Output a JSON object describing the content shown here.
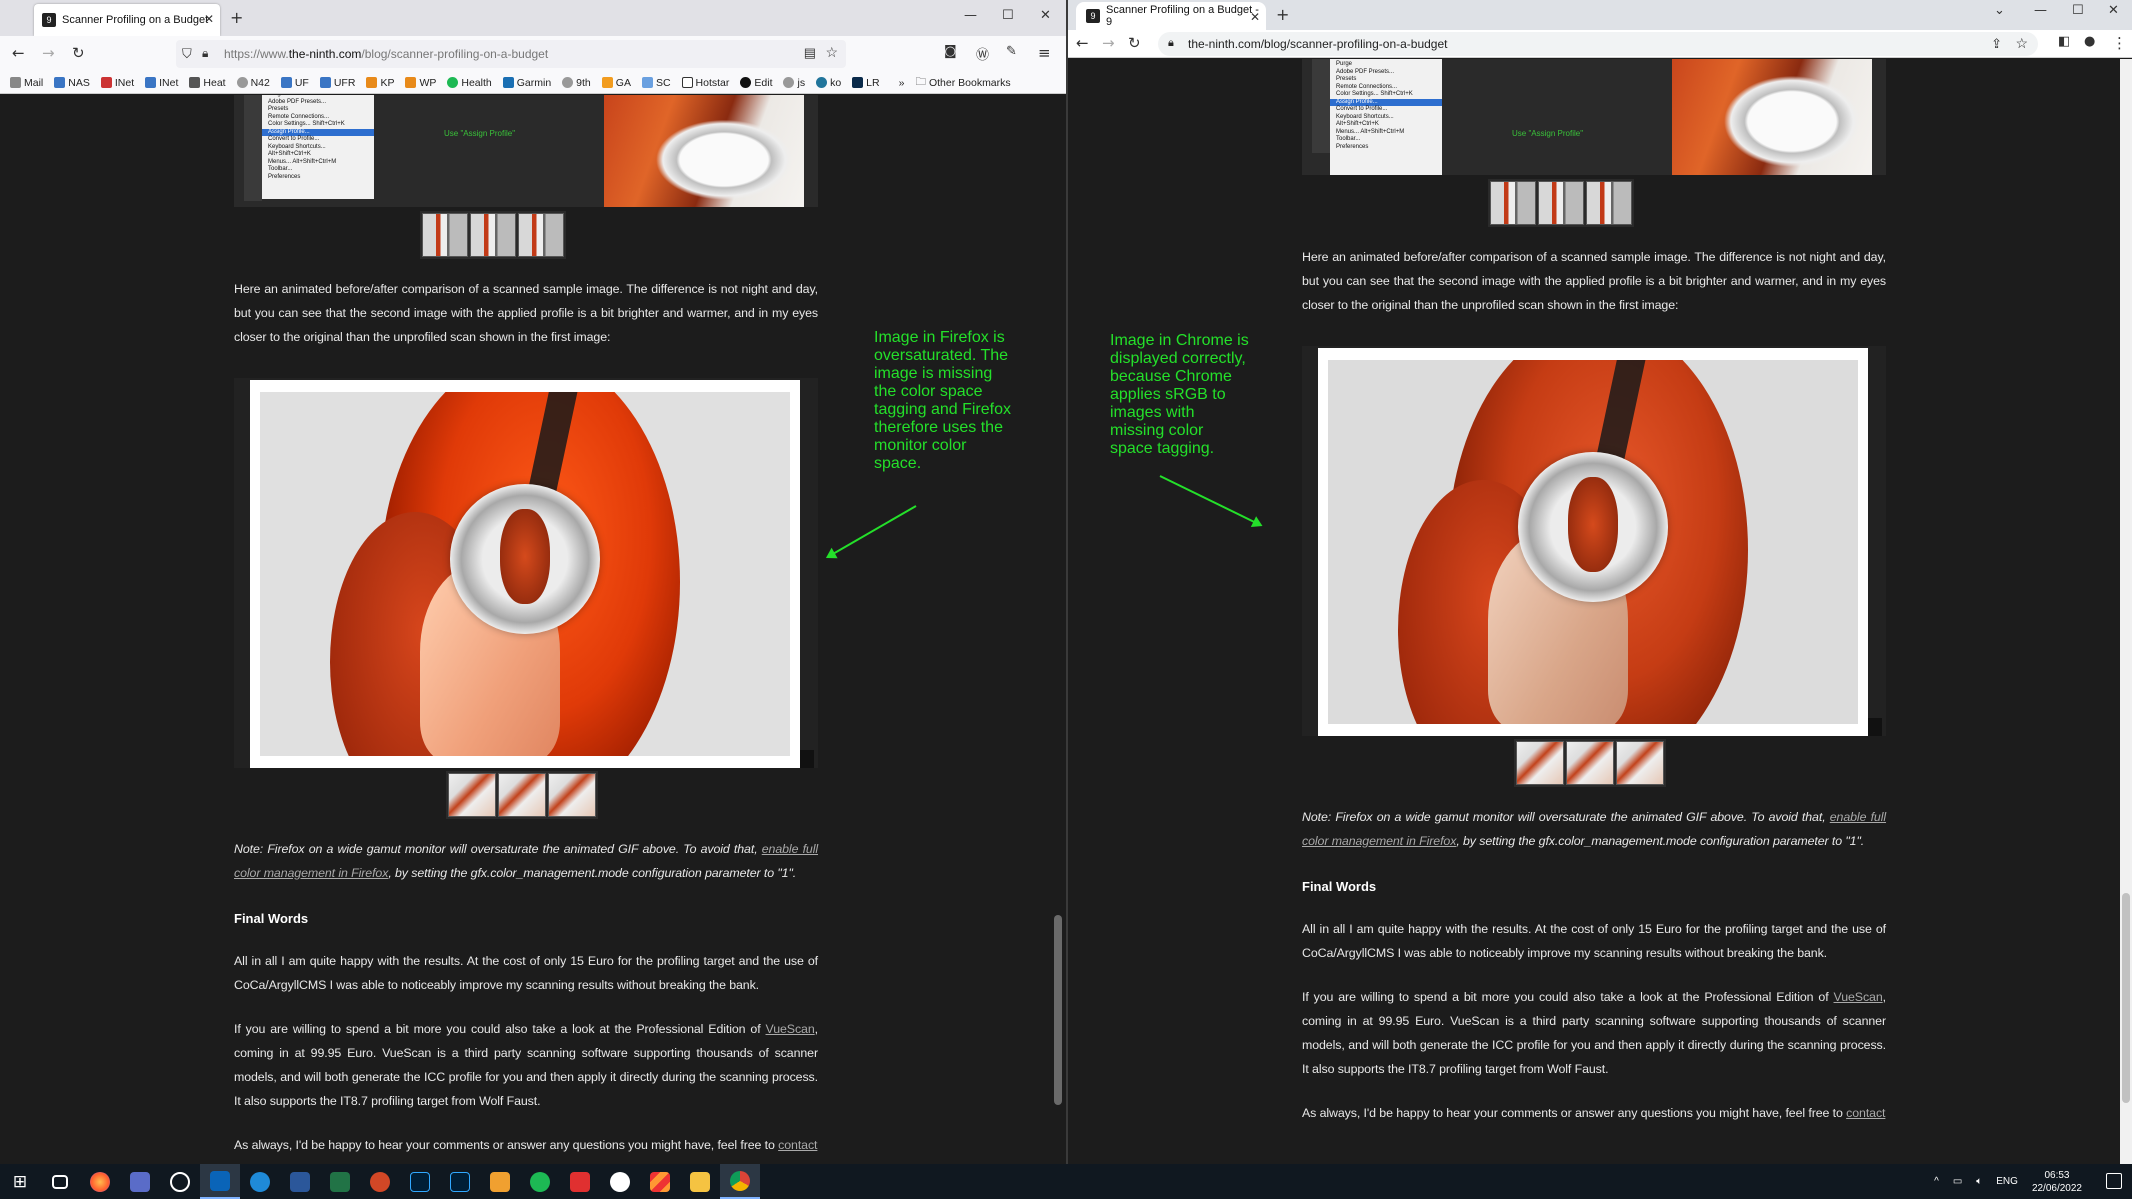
{
  "left_window": {
    "browser": "firefox",
    "tab_title": "Scanner Profiling on a Budget",
    "url_prefix": "https://www.",
    "url_domain": "the-ninth.com",
    "url_path": "/blog/scanner-profiling-on-a-budget",
    "bookmarks": [
      {
        "label": "Mail"
      },
      {
        "label": "NAS"
      },
      {
        "label": "INet"
      },
      {
        "label": "INet"
      },
      {
        "label": "Heat"
      },
      {
        "label": "N42"
      },
      {
        "label": "UF"
      },
      {
        "label": "UFR"
      },
      {
        "label": "KP"
      },
      {
        "label": "WP"
      },
      {
        "label": "Health"
      },
      {
        "label": "Garmin"
      },
      {
        "label": "9th"
      },
      {
        "label": "GA"
      },
      {
        "label": "SC"
      },
      {
        "label": "Hotstar"
      },
      {
        "label": "Edit"
      },
      {
        "label": "js"
      },
      {
        "label": "ko"
      },
      {
        "label": "LR"
      }
    ],
    "other_bookmarks": "Other Bookmarks",
    "annotation": "Image in Firefox is oversaturated. The image is missing the color space tagging and Firefox therefore uses the monitor color space."
  },
  "right_window": {
    "browser": "chrome",
    "tab_title": "Scanner Profiling on a Budget - 9",
    "url": "the-ninth.com/blog/scanner-profiling-on-a-budget",
    "annotation": "Image in Chrome is displayed correctly, because Chrome applies sRGB to images with missing color space tagging."
  },
  "photoshop_menu": {
    "items": [
      "Purge",
      "Adobe PDF Presets...",
      "Presets",
      "Remote Connections...",
      "Color Settings...   Shift+Ctrl+K",
      "Assign Profile...",
      "Convert to Profile...",
      "Keyboard Shortcuts...  Alt+Shift+Ctrl+K",
      "Menus...  Alt+Shift+Ctrl+M",
      "Toolbar...",
      "Preferences"
    ],
    "note": "Use \"Assign Profile\""
  },
  "article": {
    "para1": "Here an animated before/after comparison of a scanned sample image. The difference is not night and day, but you can see that the second image with the applied profile is a bit brighter and warmer, and in my eyes closer to the original than the unprofiled scan shown in the first image:",
    "note_before": "Note: Firefox on a wide gamut monitor will oversaturate the animated GIF above. To avoid that, ",
    "note_link": "enable full color management in Firefox",
    "note_after": ", by setting the gfx.color_management.mode configuration parameter to \"1\".",
    "heading": "Final Words",
    "para2": "All in all I am quite happy with the results. At the cost of only 15 Euro for the profiling target and the use of CoCa/ArgyllCMS I was able to noticeably improve my scanning results without breaking the bank.",
    "para3_before": "If you are willing to spend a bit more you could also take a look at the Professional Edition of ",
    "para3_link": "VueScan",
    "para3_after": ", coming in at 99.95 Euro. VueScan is a third party scanning software supporting thousands of scanner models, and will both generate the ICC profile for you and then apply it directly during the scanning process. It also supports the IT8.7 profiling target from Wolf Faust.",
    "para4_before": "As always, I'd be happy to hear your comments or answer any questions you might have, feel free to ",
    "para4_link": "contact"
  },
  "taskbar": {
    "tray_lang": "ENG",
    "time": "06:53",
    "date": "22/06/2022"
  },
  "colors": {
    "annotation_green": "#24e02a",
    "page_bg": "#1c1c1c"
  }
}
